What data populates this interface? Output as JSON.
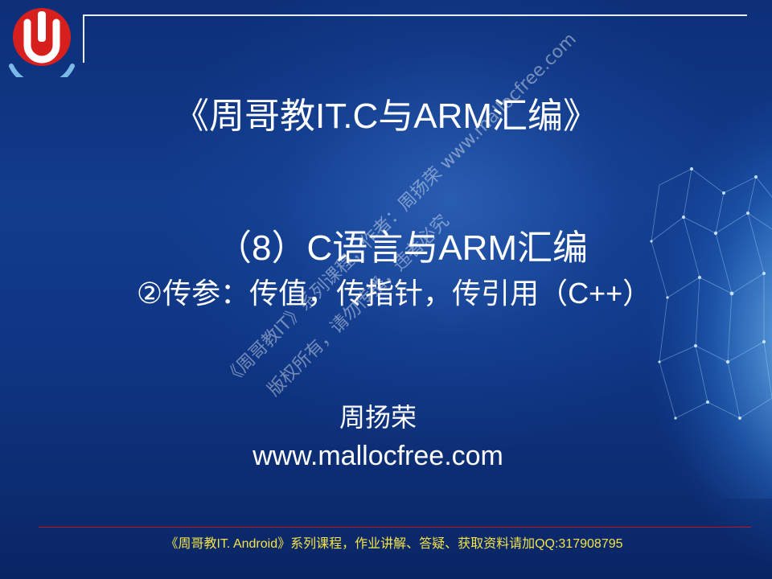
{
  "slide": {
    "title": "《周哥教IT.C与ARM汇编》",
    "subtitle_line1": "（8）C语言与ARM汇编",
    "subtitle_line2": "②传参：传值，传指针，传引用（C++）",
    "author": "周扬荣",
    "website": "www.mallocfree.com",
    "footer": "《周哥教IT. Android》系列课程，作业讲解、答疑、获取资料请加QQ:317908795"
  },
  "watermark": {
    "line1": "《周哥教IT》系列课程，作者：周扬荣 www.mallocfree.com",
    "line2": "版权所有，请勿传播，违者必究"
  },
  "logo": {
    "icon": "brand-logo-icon",
    "colors": {
      "primary": "#d7201e",
      "ring": "#7ab9e6"
    }
  },
  "colors": {
    "background": "#123c8c",
    "text": "#ffffff",
    "footer_text": "#f4e44a",
    "footer_rule": "#c2141a"
  }
}
